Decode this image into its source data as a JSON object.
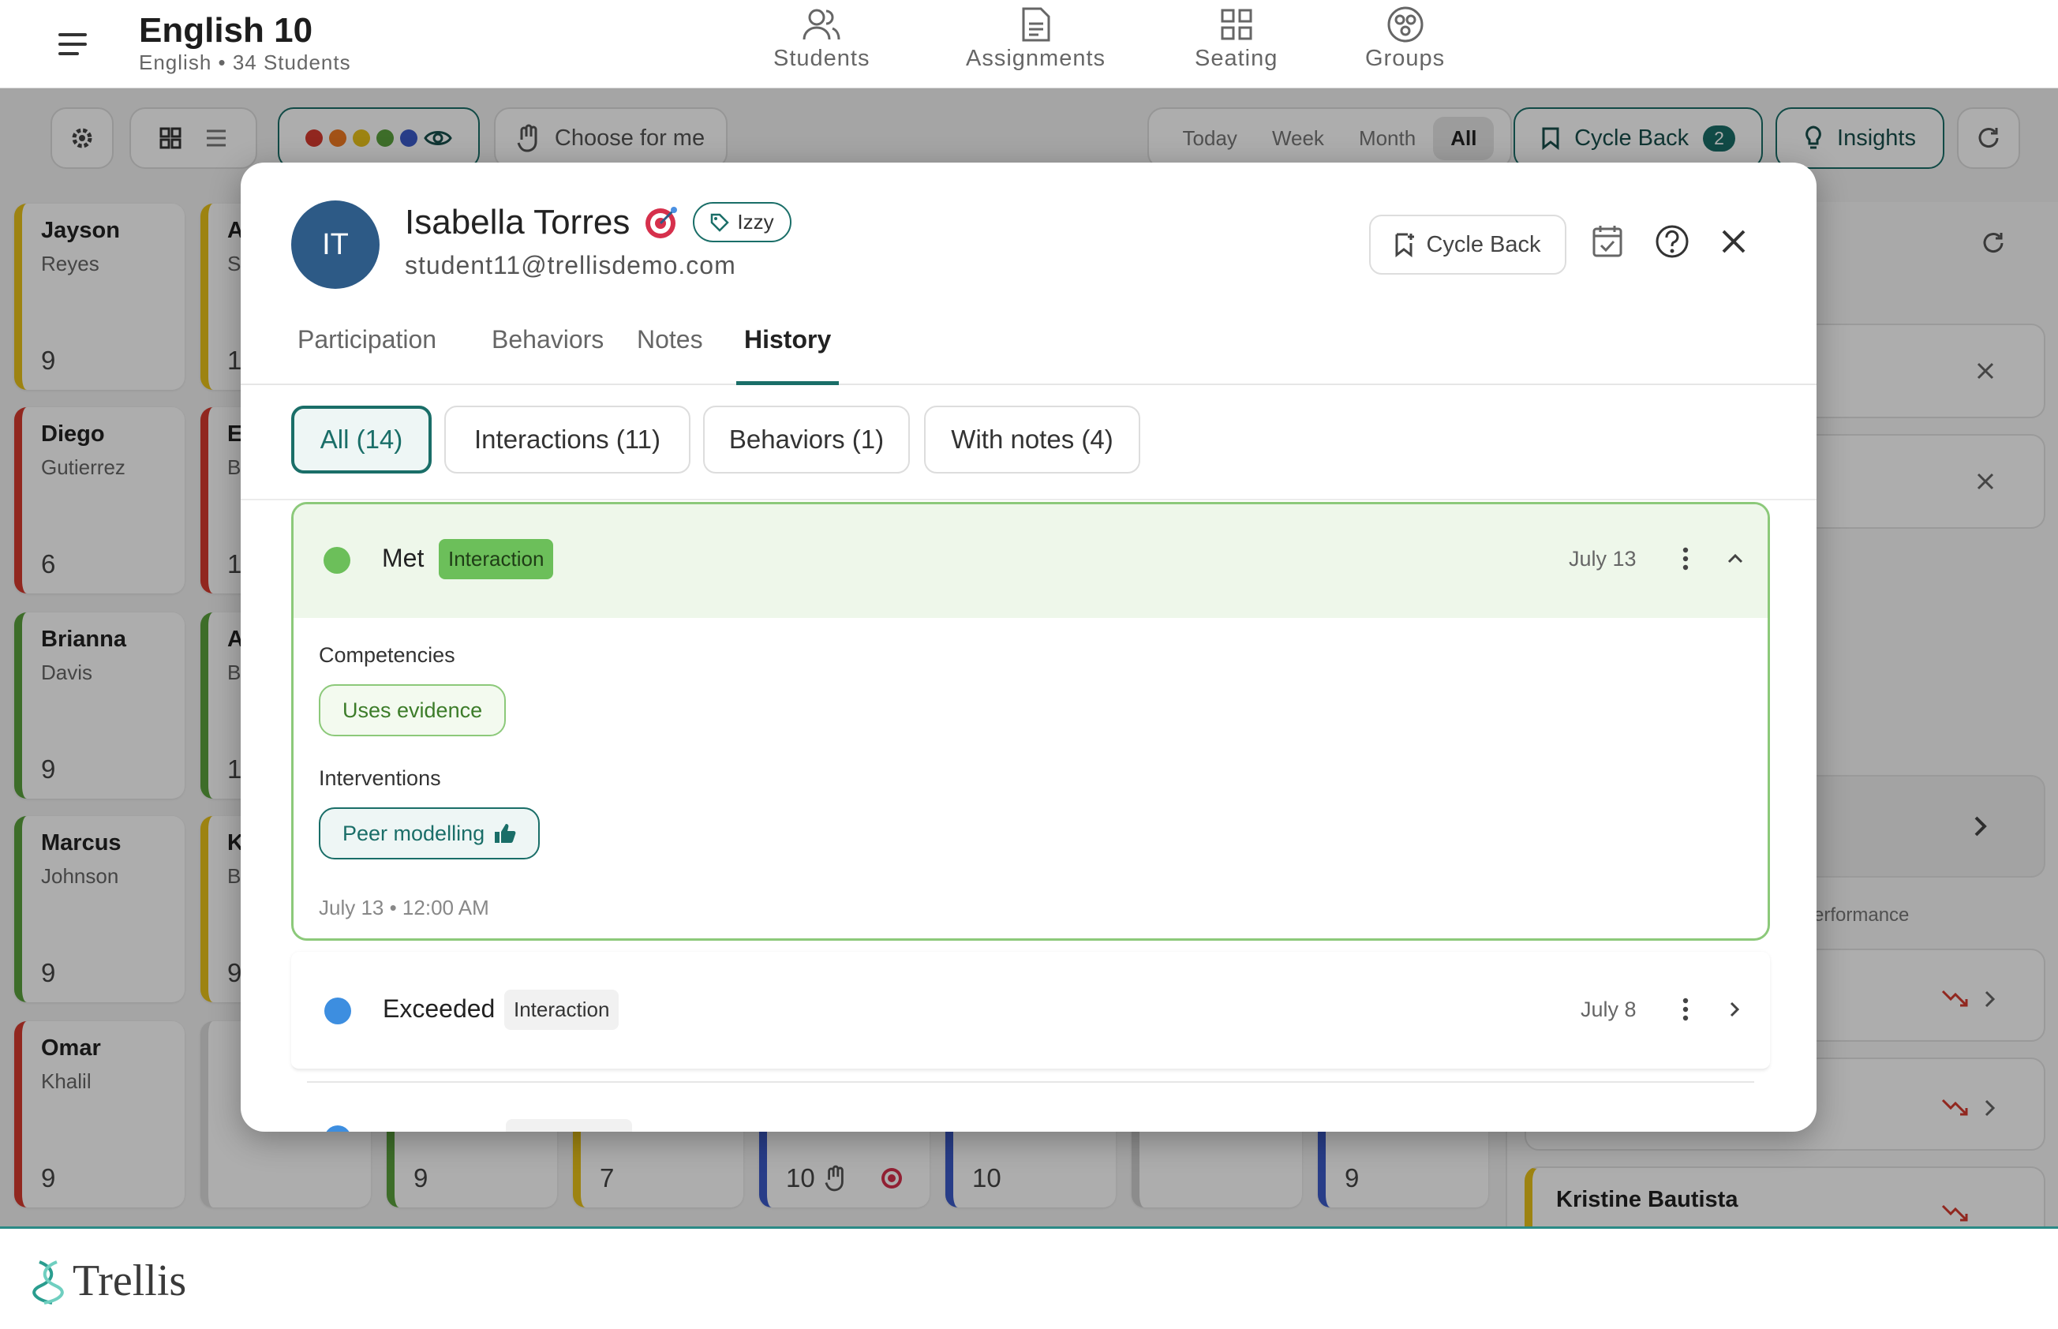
{
  "header": {
    "class_title": "English 10",
    "class_subtitle": "English • 34 Students",
    "nav": [
      {
        "label": "Students",
        "icon": "people-icon"
      },
      {
        "label": "Assignments",
        "icon": "document-icon"
      },
      {
        "label": "Seating",
        "icon": "grid-icon"
      },
      {
        "label": "Groups",
        "icon": "groups-icon"
      }
    ]
  },
  "toolbar": {
    "choose_label": "Choose for me",
    "ranges": [
      "Today",
      "Week",
      "Month",
      "All"
    ],
    "selected_range": "All",
    "cycle_back_label": "Cycle Back",
    "cycle_back_count": "2",
    "insights_label": "Insights"
  },
  "cards": [
    {
      "first": "Jayson",
      "last": "Reyes",
      "score": "9",
      "color": "#e8c21a"
    },
    {
      "first": "Diego",
      "last": "Gutierrez",
      "score": "6",
      "color": "#d63a2e"
    },
    {
      "first": "Brianna",
      "last": "Davis",
      "score": "9",
      "color": "#5aa13d"
    },
    {
      "first": "Marcus",
      "last": "Johnson",
      "score": "9",
      "color": "#5aa13d"
    },
    {
      "first": "Omar",
      "last": "Khalil",
      "score": "9",
      "color": "#d63a2e"
    }
  ],
  "col2": [
    {
      "i": "A",
      "l": "S",
      "s": "1",
      "c": "#e8c21a"
    },
    {
      "i": "E",
      "l": "B",
      "s": "1",
      "c": "#d63a2e"
    },
    {
      "i": "A",
      "l": "B",
      "s": "1",
      "c": "#5aa13d"
    },
    {
      "i": "K",
      "l": "B",
      "s": "9",
      "c": "#e8c21a"
    }
  ],
  "bottom_cards": [
    {
      "score": "9",
      "color": "#5aa13d"
    },
    {
      "score": "7",
      "color": "#e8c21a"
    },
    {
      "score": "10",
      "color": "#3b5bc9"
    },
    {
      "score": "10",
      "color": "#3b5bc9"
    },
    {
      "score": "",
      "color": "#cfcfcf"
    },
    {
      "score": "9",
      "color": "#3b5bc9"
    }
  ],
  "right_panel": {
    "performance_label": "erformance",
    "student": "Kristine Bautista"
  },
  "modal": {
    "initials": "IT",
    "student_name": "Isabella Torres",
    "nickname": "Izzy",
    "email": "student11@trellisdemo.com",
    "cycle_back_label": "Cycle Back",
    "tabs": [
      "Participation",
      "Behaviors",
      "Notes",
      "History"
    ],
    "active_tab": "History",
    "filters": [
      "All (14)",
      "Interactions (11)",
      "Behaviors (1)",
      "With notes (4)"
    ],
    "entry1": {
      "status": "Met",
      "type": "Interaction",
      "date": "July 13",
      "competencies_label": "Competencies",
      "competency": "Uses evidence",
      "interventions_label": "Interventions",
      "intervention": "Peer modelling",
      "timestamp": "July 13 • 12:00 AM",
      "status_color": "#6cbf5a"
    },
    "entry2": {
      "status": "Exceeded",
      "type": "Interaction",
      "date": "July 8",
      "status_color": "#3d8ee0"
    }
  },
  "footer": {
    "brand": "Trellis"
  }
}
